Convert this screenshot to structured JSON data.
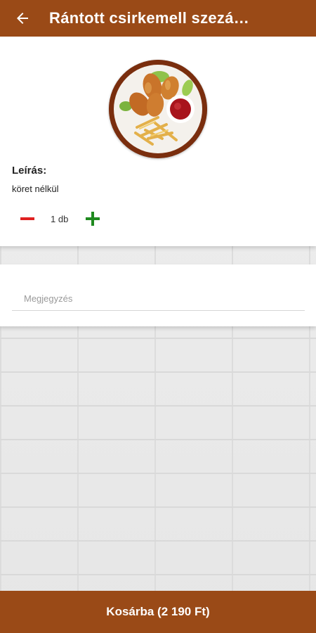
{
  "colors": {
    "brand": "#9a4a17",
    "minus": "#e02020",
    "plus": "#1f8a1f"
  },
  "header": {
    "title": "Rántott csirkemell szezá…",
    "back_icon": "arrow-left-icon"
  },
  "product": {
    "image_alt": "fried chicken drumsticks with fries and ketchup",
    "description_heading": "Leírás:",
    "description": "köret nélkül",
    "quantity": {
      "minus_icon": "minus-icon",
      "value": "1 db",
      "plus_icon": "plus-icon"
    }
  },
  "note": {
    "placeholder": "Megjegyzés",
    "value": ""
  },
  "cart_button": {
    "label": "Kosárba (2 190 Ft)"
  }
}
